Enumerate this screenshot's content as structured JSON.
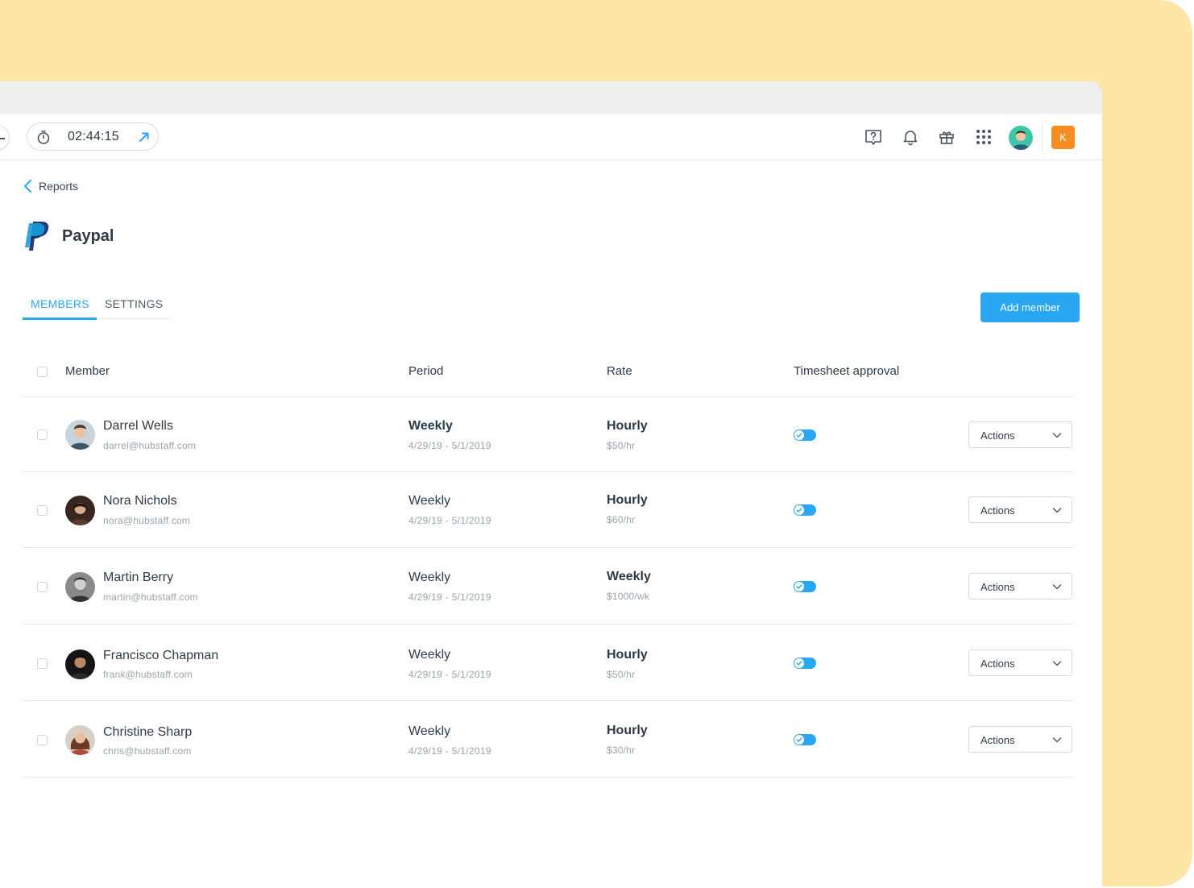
{
  "timer": {
    "time": "02:44:15"
  },
  "org": {
    "initial": "K"
  },
  "breadcrumb": {
    "label": "Reports"
  },
  "page": {
    "title": "Paypal"
  },
  "tabs": [
    {
      "label": "MEMBERS",
      "active": true
    },
    {
      "label": "SETTINGS",
      "active": false
    }
  ],
  "add_member": {
    "label": "Add member"
  },
  "table": {
    "headers": {
      "member": "Member",
      "period": "Period",
      "rate": "Rate",
      "approval": "Timesheet approval"
    },
    "rows": [
      {
        "name": "Darrel Wells",
        "email": "darrel@hubstaff.com",
        "period": "Weekly",
        "dates": "4/29/19 - 5/1/2019",
        "rate_type": "Hourly",
        "rate": "$50/hr",
        "approval": true,
        "actions": "Actions"
      },
      {
        "name": "Nora Nichols",
        "email": "nora@hubstaff.com",
        "period": "Weekly",
        "dates": "4/29/19 - 5/1/2019",
        "rate_type": "Hourly",
        "rate": "$60/hr",
        "approval": true,
        "actions": "Actions"
      },
      {
        "name": "Martin Berry",
        "email": "martin@hubstaff.com",
        "period": "Weekly",
        "dates": "4/29/19 - 5/1/2019",
        "rate_type": "Weekly",
        "rate": "$1000/wk",
        "approval": true,
        "actions": "Actions"
      },
      {
        "name": "Francisco Chapman",
        "email": "frank@hubstaff.com",
        "period": "Weekly",
        "dates": "4/29/19 - 5/1/2019",
        "rate_type": "Hourly",
        "rate": "$50/hr",
        "approval": true,
        "actions": "Actions"
      },
      {
        "name": "Christine Sharp",
        "email": "chris@hubstaff.com",
        "period": "Weekly",
        "dates": "4/29/19 - 5/1/2019",
        "rate_type": "Hourly",
        "rate": "$30/hr",
        "approval": true,
        "actions": "Actions"
      }
    ]
  },
  "colors": {
    "accent": "#2aa7f3",
    "org_badge": "#f58d20",
    "backdrop": "#fee6a7"
  },
  "icons": [
    "stopwatch-icon",
    "external-arrow-icon",
    "help-icon",
    "bell-icon",
    "gift-icon",
    "apps-grid-icon",
    "chevron-left-icon",
    "paypal-logo-icon",
    "chevron-down-icon",
    "check-icon"
  ]
}
